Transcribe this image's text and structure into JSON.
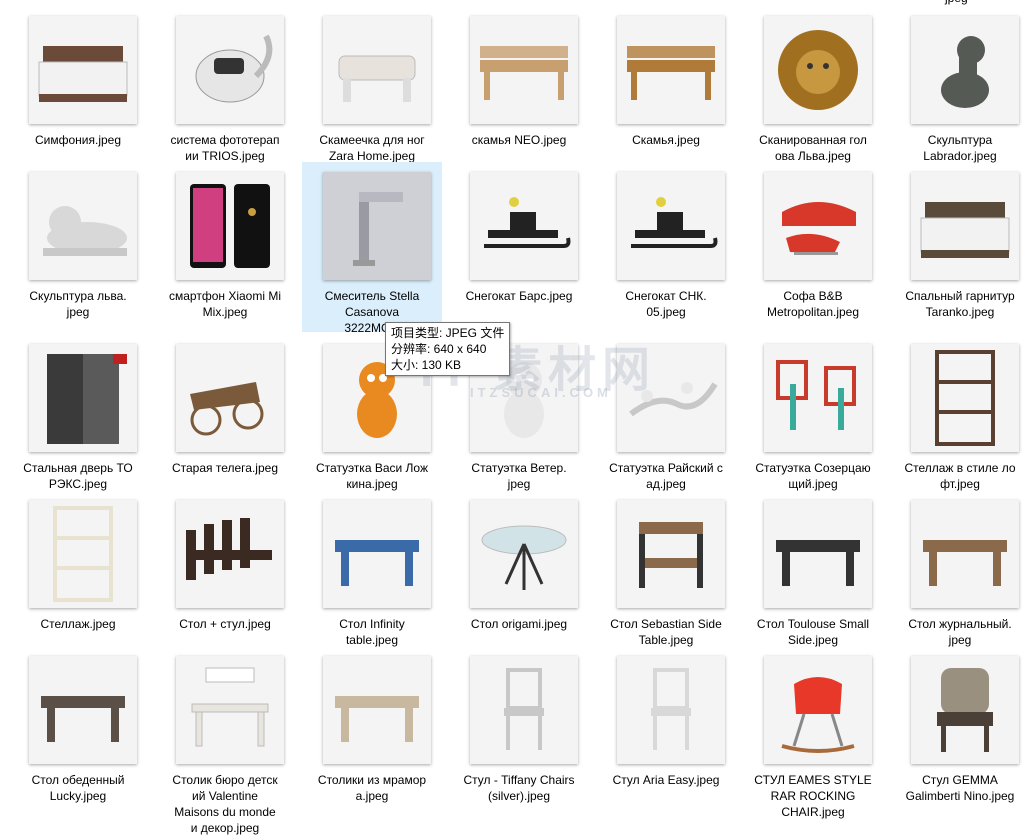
{
  "top_fragment": "jpeg",
  "items": [
    {
      "name": "Симфония.jpeg",
      "icon": "bed-icon",
      "color": "#6b4a3a"
    },
    {
      "name": "система фототерапии TRIOS.jpeg",
      "icon": "device-icon",
      "color": "#333333"
    },
    {
      "name": "Скамеечка для ног Zara Home.jpeg",
      "icon": "footstool-icon",
      "color": "#e8e2dc"
    },
    {
      "name": "скамья NEO.jpeg",
      "icon": "bench-icon",
      "color": "#c8a070"
    },
    {
      "name": "Скамья.jpeg",
      "icon": "bench-icon",
      "color": "#b07a38"
    },
    {
      "name": "Сканированная голова Льва.jpeg",
      "icon": "lion-icon",
      "color": "#a07020"
    },
    {
      "name": "Скульптура Labrador.jpeg",
      "icon": "dog-statue-icon",
      "color": "#555a55"
    },
    {
      "name": "Скульптура льва.jpeg",
      "icon": "lion-statue-icon",
      "color": "#d8d8d8"
    },
    {
      "name": "смартфон Xiaomi Mi Mix.jpeg",
      "icon": "phone-icon",
      "color": "#111111"
    },
    {
      "name": "Смеситель Stella Casanova 3222MC...",
      "icon": "faucet-icon",
      "color": "#9a9aa2"
    },
    {
      "name": "Снегокат Барс.jpeg",
      "icon": "sled-icon",
      "color": "#222222"
    },
    {
      "name": "Снегокат СНК.05.jpeg",
      "icon": "sled-icon",
      "color": "#222222"
    },
    {
      "name": "Софа B&B Metropolitan.jpeg",
      "icon": "sofa-icon",
      "color": "#d8382a"
    },
    {
      "name": "Спальный гарнитур Taranko.jpeg",
      "icon": "bed-icon",
      "color": "#5a4a3a"
    },
    {
      "name": "Стальная дверь ТОРЭКС.jpeg",
      "icon": "door-icon",
      "color": "#3a3a3a"
    },
    {
      "name": "Старая телега.jpeg",
      "icon": "cart-icon",
      "color": "#7a5a3a"
    },
    {
      "name": "Статуэтка Васи Ложкина.jpeg",
      "icon": "figurine-icon",
      "color": "#e88a20"
    },
    {
      "name": "Статуэтка Ветер.jpeg",
      "icon": "figurine-icon",
      "color": "#e8e8e8"
    },
    {
      "name": "Статуэтка Райский сад.jpeg",
      "icon": "branch-icon",
      "color": "#c8c8c8"
    },
    {
      "name": "Статуэтка Созерцающий.jpeg",
      "icon": "frame-figure-icon",
      "color": "#c83a2a"
    },
    {
      "name": "Стеллаж в стиле лофт.jpeg",
      "icon": "shelf-icon",
      "color": "#5a4030"
    },
    {
      "name": "Стеллаж.jpeg",
      "icon": "shelf-icon",
      "color": "#e8e2d0"
    },
    {
      "name": "Стол + стул.jpeg",
      "icon": "dining-set-icon",
      "color": "#3a2a22"
    },
    {
      "name": "Стол Infinity table.jpeg",
      "icon": "table-icon",
      "color": "#3a6aa8"
    },
    {
      "name": "Стол origami.jpeg",
      "icon": "glass-table-icon",
      "color": "#bcd8e0"
    },
    {
      "name": "Стол Sebastian Side Table.jpeg",
      "icon": "side-table-icon",
      "color": "#8a6a4a"
    },
    {
      "name": "Стол Toulouse Small Side.jpeg",
      "icon": "table-icon",
      "color": "#333333"
    },
    {
      "name": "Стол журнальный.jpeg",
      "icon": "table-icon",
      "color": "#8a6a4a"
    },
    {
      "name": "Стол обеденный Lucky.jpeg",
      "icon": "table-icon",
      "color": "#5a5048"
    },
    {
      "name": "Столик бюро детский Valentine Maisons du monde и декор.jpeg",
      "icon": "desk-icon",
      "color": "#e8e4de"
    },
    {
      "name": "Столики из мрамора.jpeg",
      "icon": "table-icon",
      "color": "#c8b8a0"
    },
    {
      "name": "Стул - Tiffany Chairs (silver).jpeg",
      "icon": "chair-icon",
      "color": "#c8c8c8"
    },
    {
      "name": "Стул Aria Easy.jpeg",
      "icon": "chair-icon",
      "color": "#d8d8d8"
    },
    {
      "name": "СТУЛ EAMES STYLE RAR ROCKING CHAIR.jpeg",
      "icon": "rocking-chair-icon",
      "color": "#e8382a"
    },
    {
      "name": "Стул GEMMA Galimberti Nino.jpeg",
      "icon": "armchair-icon",
      "color": "#4a4038"
    }
  ],
  "captions": [
    "Симфония.jpeg",
    "система фототерап\nии TRIOS.jpeg",
    "Скамеечка для ног\nZara Home.jpeg",
    "скамья NEO.jpeg",
    "Скамья.jpeg",
    "Сканированная гол\nова Льва.jpeg",
    "Скульптура\nLabrador.jpeg",
    "Скульптура льва.\njpeg",
    "смартфон Xiaomi Mi\nMix.jpeg",
    "Смеситель Stella\nCasanova\n3222MC...",
    "Снегокат Барс.jpeg",
    "Снегокат СНК.\n05.jpeg",
    "Софа B&B\nMetropolitan.jpeg",
    "Спальный гарнитур\nTaranko.jpeg",
    "Стальная дверь ТО\nРЭКС.jpeg",
    "Старая телега.jpeg",
    "Статуэтка Васи Лож\nкина.jpeg",
    "Статуэтка Ветер.\njpeg",
    "Статуэтка Райский с\nад.jpeg",
    "Статуэтка Созерцаю\nщий.jpeg",
    "Стеллаж в стиле ло\nфт.jpeg",
    "Стеллаж.jpeg",
    "Стол + стул.jpeg",
    "Стол Infinity\ntable.jpeg",
    "Стол origami.jpeg",
    "Стол Sebastian Side\nTable.jpeg",
    "Стол Toulouse Small\nSide.jpeg",
    "Стол журнальный.\njpeg",
    "Стол обеденный\nLucky.jpeg",
    "Столик бюро детск\nий Valentine\nMaisons du monde\nи декор.jpeg",
    "Столики из мрамор\nа.jpeg",
    "Стул - Tiffany Chairs\n(silver).jpeg",
    "Стул Aria Easy.jpeg",
    "СТУЛ EAMES STYLE\nRAR ROCKING\nCHAIR.jpeg",
    "Стул GEMMA\nGalimberti Nino.jpeg"
  ],
  "selected_index": 9,
  "tooltip": {
    "type_line": "项目类型: JPEG 文件",
    "res_line": "分辨率: 640 x 640",
    "size_line": "大小: 130 KB"
  },
  "watermark": {
    "main": "IT 素材网",
    "sub": "ITZSUCAI.COM"
  }
}
